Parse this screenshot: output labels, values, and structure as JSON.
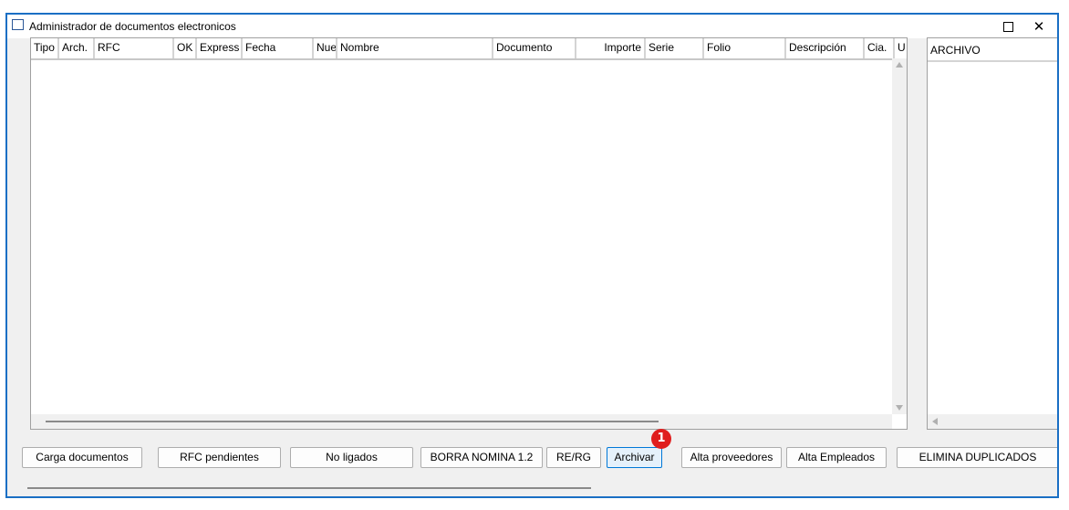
{
  "window": {
    "title": "Administrador de documentos electronicos",
    "maximize_glyph": "",
    "close_glyph": "✕"
  },
  "grid": {
    "columns": [
      {
        "label": "Tipo",
        "w": 31
      },
      {
        "label": "Arch.",
        "w": 39
      },
      {
        "label": "RFC",
        "w": 87
      },
      {
        "label": "OK",
        "w": 25
      },
      {
        "label": "Express",
        "w": 50
      },
      {
        "label": "Fecha",
        "w": 78
      },
      {
        "label": "Nue",
        "w": 26
      },
      {
        "label": "Nombre",
        "w": 171
      },
      {
        "label": "Documento",
        "w": 91
      },
      {
        "label": "Importe",
        "w": 76,
        "align": "right"
      },
      {
        "label": "Serie",
        "w": 64
      },
      {
        "label": "Folio",
        "w": 90
      },
      {
        "label": "Descripción",
        "w": 86
      },
      {
        "label": "Cia.",
        "w": 33
      },
      {
        "label": "U",
        "w": 40
      }
    ]
  },
  "archivo_panel": {
    "header": "ARCHIVO"
  },
  "buttons": {
    "carga_documentos": "Carga documentos",
    "rfc_pendientes": "RFC pendientes",
    "no_ligados": "No ligados",
    "borra_nomina": "BORRA NOMINA 1.2",
    "re_rg": "RE/RG",
    "archivar": "Archivar",
    "alta_proveedores": "Alta proveedores",
    "alta_empleados": "Alta Empleados",
    "elimina_duplicados": "ELIMINA DUPLICADOS"
  },
  "badge": {
    "number": "1",
    "color": "#e01e1e"
  },
  "colors": {
    "accent": "#1a6fc4",
    "focus": "#0078d7"
  }
}
